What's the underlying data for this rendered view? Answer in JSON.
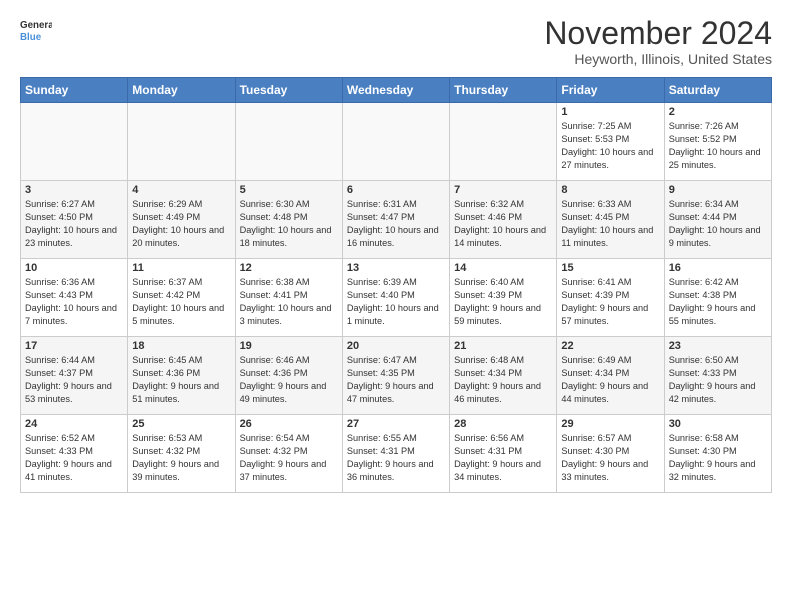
{
  "header": {
    "logo_line1": "General",
    "logo_line2": "Blue",
    "month": "November 2024",
    "location": "Heyworth, Illinois, United States"
  },
  "weekdays": [
    "Sunday",
    "Monday",
    "Tuesday",
    "Wednesday",
    "Thursday",
    "Friday",
    "Saturday"
  ],
  "weeks": [
    [
      {
        "day": "",
        "info": ""
      },
      {
        "day": "",
        "info": ""
      },
      {
        "day": "",
        "info": ""
      },
      {
        "day": "",
        "info": ""
      },
      {
        "day": "",
        "info": ""
      },
      {
        "day": "1",
        "info": "Sunrise: 7:25 AM\nSunset: 5:53 PM\nDaylight: 10 hours and 27 minutes."
      },
      {
        "day": "2",
        "info": "Sunrise: 7:26 AM\nSunset: 5:52 PM\nDaylight: 10 hours and 25 minutes."
      }
    ],
    [
      {
        "day": "3",
        "info": "Sunrise: 6:27 AM\nSunset: 4:50 PM\nDaylight: 10 hours and 23 minutes."
      },
      {
        "day": "4",
        "info": "Sunrise: 6:29 AM\nSunset: 4:49 PM\nDaylight: 10 hours and 20 minutes."
      },
      {
        "day": "5",
        "info": "Sunrise: 6:30 AM\nSunset: 4:48 PM\nDaylight: 10 hours and 18 minutes."
      },
      {
        "day": "6",
        "info": "Sunrise: 6:31 AM\nSunset: 4:47 PM\nDaylight: 10 hours and 16 minutes."
      },
      {
        "day": "7",
        "info": "Sunrise: 6:32 AM\nSunset: 4:46 PM\nDaylight: 10 hours and 14 minutes."
      },
      {
        "day": "8",
        "info": "Sunrise: 6:33 AM\nSunset: 4:45 PM\nDaylight: 10 hours and 11 minutes."
      },
      {
        "day": "9",
        "info": "Sunrise: 6:34 AM\nSunset: 4:44 PM\nDaylight: 10 hours and 9 minutes."
      }
    ],
    [
      {
        "day": "10",
        "info": "Sunrise: 6:36 AM\nSunset: 4:43 PM\nDaylight: 10 hours and 7 minutes."
      },
      {
        "day": "11",
        "info": "Sunrise: 6:37 AM\nSunset: 4:42 PM\nDaylight: 10 hours and 5 minutes."
      },
      {
        "day": "12",
        "info": "Sunrise: 6:38 AM\nSunset: 4:41 PM\nDaylight: 10 hours and 3 minutes."
      },
      {
        "day": "13",
        "info": "Sunrise: 6:39 AM\nSunset: 4:40 PM\nDaylight: 10 hours and 1 minute."
      },
      {
        "day": "14",
        "info": "Sunrise: 6:40 AM\nSunset: 4:39 PM\nDaylight: 9 hours and 59 minutes."
      },
      {
        "day": "15",
        "info": "Sunrise: 6:41 AM\nSunset: 4:39 PM\nDaylight: 9 hours and 57 minutes."
      },
      {
        "day": "16",
        "info": "Sunrise: 6:42 AM\nSunset: 4:38 PM\nDaylight: 9 hours and 55 minutes."
      }
    ],
    [
      {
        "day": "17",
        "info": "Sunrise: 6:44 AM\nSunset: 4:37 PM\nDaylight: 9 hours and 53 minutes."
      },
      {
        "day": "18",
        "info": "Sunrise: 6:45 AM\nSunset: 4:36 PM\nDaylight: 9 hours and 51 minutes."
      },
      {
        "day": "19",
        "info": "Sunrise: 6:46 AM\nSunset: 4:36 PM\nDaylight: 9 hours and 49 minutes."
      },
      {
        "day": "20",
        "info": "Sunrise: 6:47 AM\nSunset: 4:35 PM\nDaylight: 9 hours and 47 minutes."
      },
      {
        "day": "21",
        "info": "Sunrise: 6:48 AM\nSunset: 4:34 PM\nDaylight: 9 hours and 46 minutes."
      },
      {
        "day": "22",
        "info": "Sunrise: 6:49 AM\nSunset: 4:34 PM\nDaylight: 9 hours and 44 minutes."
      },
      {
        "day": "23",
        "info": "Sunrise: 6:50 AM\nSunset: 4:33 PM\nDaylight: 9 hours and 42 minutes."
      }
    ],
    [
      {
        "day": "24",
        "info": "Sunrise: 6:52 AM\nSunset: 4:33 PM\nDaylight: 9 hours and 41 minutes."
      },
      {
        "day": "25",
        "info": "Sunrise: 6:53 AM\nSunset: 4:32 PM\nDaylight: 9 hours and 39 minutes."
      },
      {
        "day": "26",
        "info": "Sunrise: 6:54 AM\nSunset: 4:32 PM\nDaylight: 9 hours and 37 minutes."
      },
      {
        "day": "27",
        "info": "Sunrise: 6:55 AM\nSunset: 4:31 PM\nDaylight: 9 hours and 36 minutes."
      },
      {
        "day": "28",
        "info": "Sunrise: 6:56 AM\nSunset: 4:31 PM\nDaylight: 9 hours and 34 minutes."
      },
      {
        "day": "29",
        "info": "Sunrise: 6:57 AM\nSunset: 4:30 PM\nDaylight: 9 hours and 33 minutes."
      },
      {
        "day": "30",
        "info": "Sunrise: 6:58 AM\nSunset: 4:30 PM\nDaylight: 9 hours and 32 minutes."
      }
    ]
  ]
}
